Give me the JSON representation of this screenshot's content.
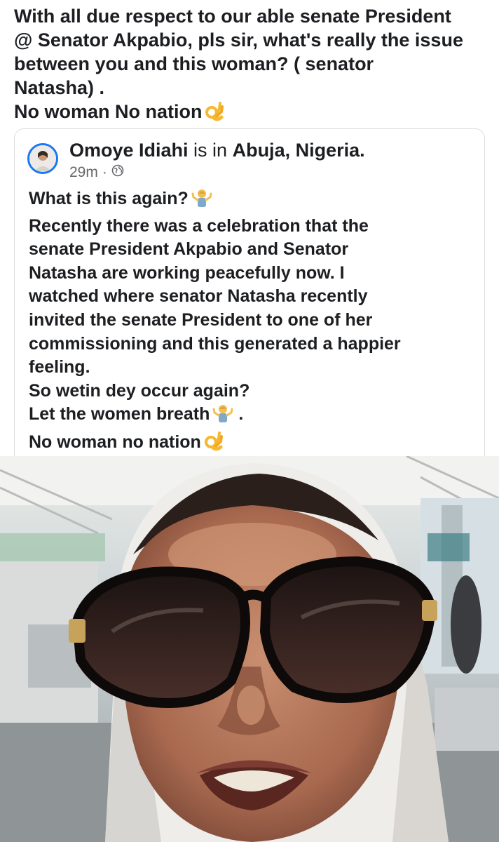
{
  "post": {
    "text_lines": [
      "With all due respect to our able senate President",
      "@ Senator Akpabio, pls sir, what's really the issue",
      "between you and this woman? ( senator",
      "Natasha) .",
      "No woman No nation"
    ],
    "end_emoji": "ok-hand-icon"
  },
  "shared_post": {
    "author": "Omoye Idiahi",
    "connector": " is in ",
    "location": "Abuja, Nigeria.",
    "time": "29m",
    "separator": "·",
    "audience_icon": "globe-icon",
    "body_lines": [
      "What is this again?",
      "Recently there was a celebration that the",
      "senate President Akpabio and Senator",
      "Natasha  are working peacefully now. I",
      "watched where senator Natasha recently",
      "invited the senate President to one of her",
      "commissioning and this generated a happier",
      "feeling.",
      "So wetin dey occur again?",
      "Let the women breath",
      "No woman no nation"
    ],
    "line_emojis": {
      "0": "shrug-icon",
      "9": "shrug-icon",
      "10": "ok-hand-icon"
    },
    "line_suffix": {
      "9": " ."
    }
  },
  "photo": {
    "subject": "woman-in-sunglasses-and-white-headscarf"
  },
  "colors": {
    "text": "#1c1e21",
    "muted": "#65676b",
    "card_border": "#dadde1",
    "avatar_ring": "#1877f2",
    "emoji_yellow": "#f5b82e"
  }
}
